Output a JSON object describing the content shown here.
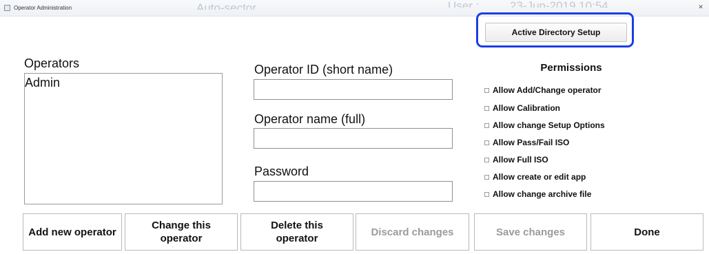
{
  "window": {
    "title": "Operator Administration",
    "watermark": [
      "Auto-sector",
      "User :",
      "23-Jun-2019 10:54"
    ],
    "close_glyph": "✕"
  },
  "active_directory_button": "Active Directory Setup",
  "operators": {
    "label": "Operators",
    "items": [
      "Admin"
    ]
  },
  "fields": {
    "operator_id": {
      "label": "Operator ID (short name)",
      "value": ""
    },
    "operator_name": {
      "label": "Operator name (full)",
      "value": ""
    },
    "password": {
      "label": "Password",
      "value": ""
    }
  },
  "permissions": {
    "title": "Permissions",
    "items": [
      {
        "label": "Allow Add/Change operator",
        "checked": false
      },
      {
        "label": "Allow Calibration",
        "checked": false
      },
      {
        "label": "Allow change Setup Options",
        "checked": false
      },
      {
        "label": "Allow Pass/Fail ISO",
        "checked": false
      },
      {
        "label": "Allow Full ISO",
        "checked": false
      },
      {
        "label": "Allow create or edit app",
        "checked": false
      },
      {
        "label": "Allow change archive file",
        "checked": false
      }
    ]
  },
  "buttons": {
    "add": "Add new operator",
    "change": [
      "Change this",
      "operator"
    ],
    "delete": [
      "Delete this",
      "operator"
    ],
    "discard": "Discard changes",
    "save": "Save changes",
    "done": "Done"
  },
  "colors": {
    "highlight": "#1a3ee6",
    "disabled_text": "#9b9b9b"
  }
}
